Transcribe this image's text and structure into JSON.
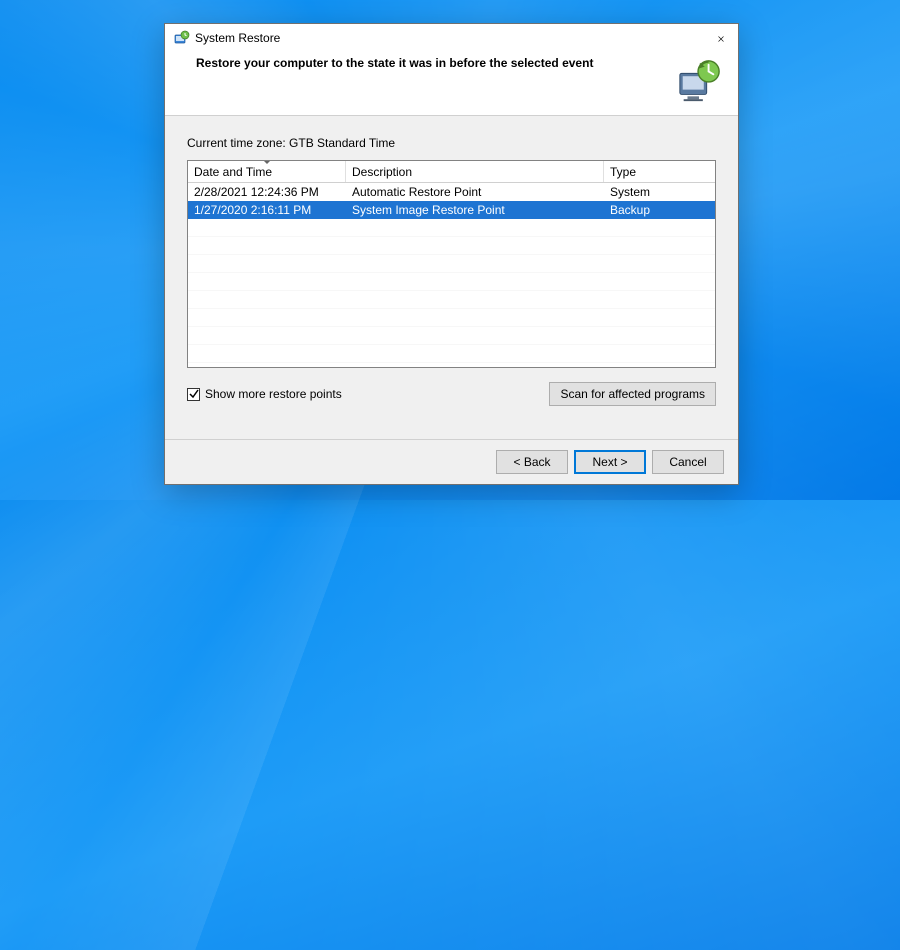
{
  "window": {
    "title": "System Restore",
    "heading": "Restore your computer to the state it was in before the selected event"
  },
  "timezone_label": "Current time zone: GTB Standard Time",
  "columns": {
    "date": "Date and Time",
    "desc": "Description",
    "type": "Type"
  },
  "rows": [
    {
      "date": "2/28/2021 12:24:36 PM",
      "desc": "Automatic Restore Point",
      "type": "System",
      "selected": false
    },
    {
      "date": "1/27/2020 2:16:11 PM",
      "desc": "System Image Restore Point",
      "type": "Backup",
      "selected": true
    }
  ],
  "checkbox": {
    "checked": true,
    "label": "Show more restore points"
  },
  "buttons": {
    "scan": "Scan for affected programs",
    "back": "< Back",
    "next": "Next >",
    "cancel": "Cancel"
  }
}
